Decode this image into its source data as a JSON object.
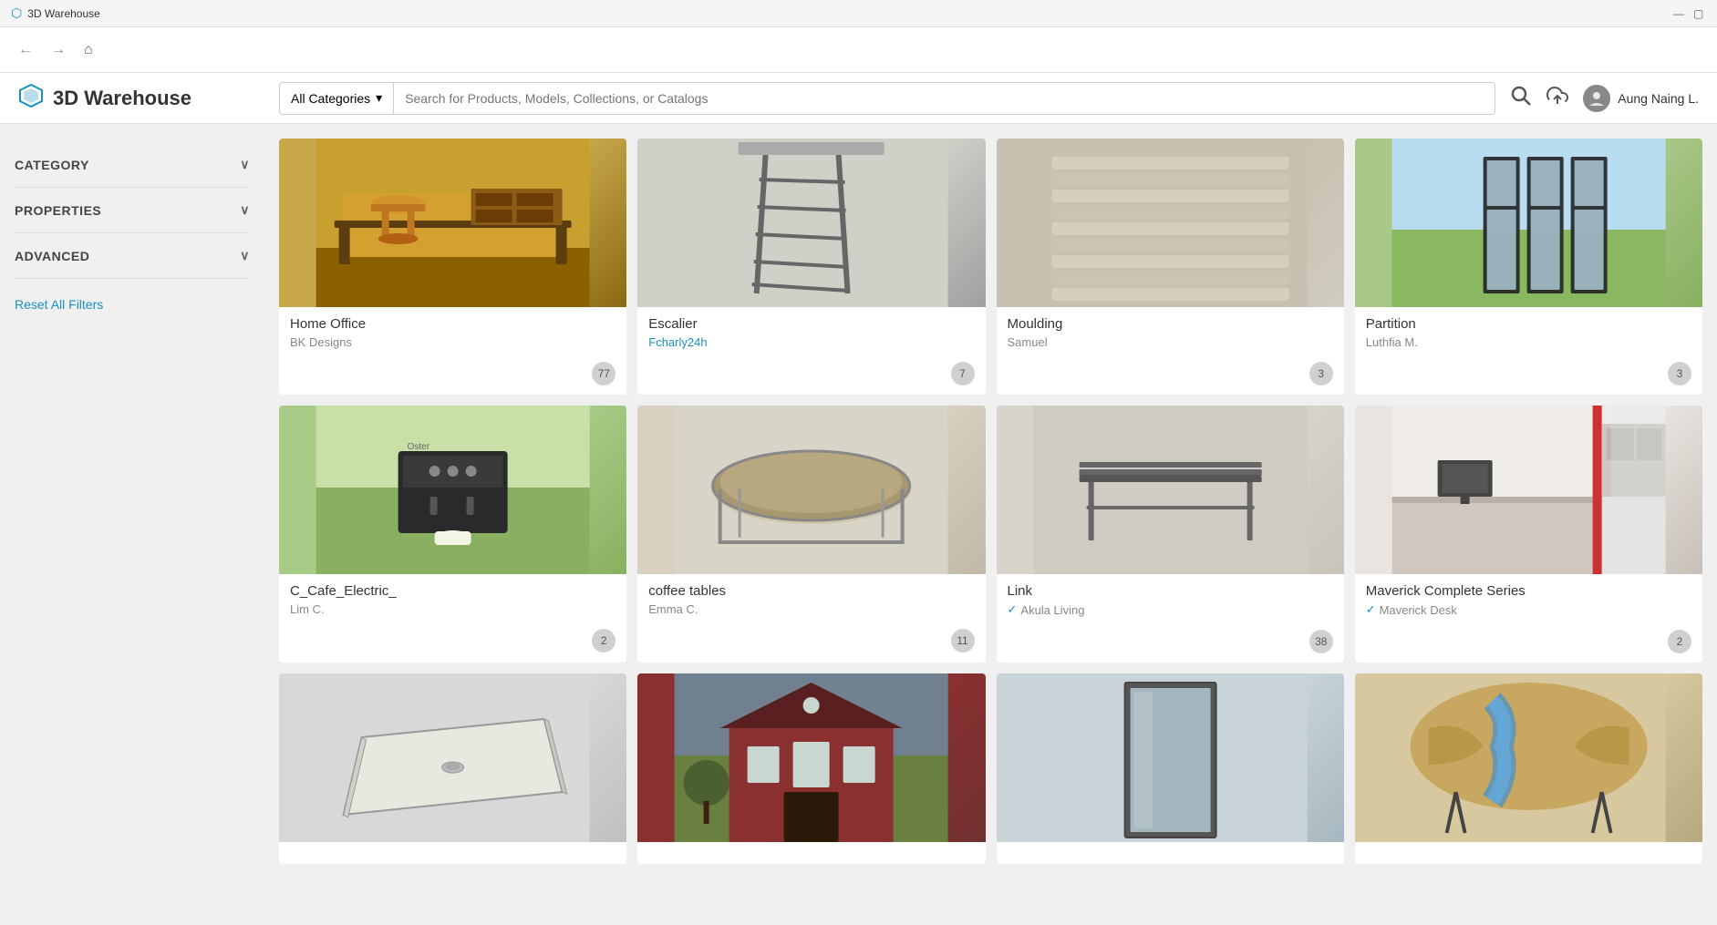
{
  "titleBar": {
    "title": "3D Warehouse",
    "icon": "⬡"
  },
  "navBar": {
    "back": "←",
    "forward": "→",
    "home": "⌂"
  },
  "header": {
    "logoText": "3D Warehouse",
    "categoryDropdown": "All Categories",
    "searchPlaceholder": "Search for Products, Models, Collections, or Catalogs",
    "userName": "Aung Naing L."
  },
  "sidebar": {
    "categoryLabel": "CATEGORY",
    "propertiesLabel": "PROPERTIES",
    "advancedLabel": "ADVANCED",
    "resetLabel": "Reset All Filters"
  },
  "cards": [
    {
      "id": "home-office",
      "title": "Home Office",
      "author": "BK Designs",
      "count": "77",
      "verified": false,
      "imgClass": "card-img-home-office"
    },
    {
      "id": "escalier",
      "title": "Escalier",
      "author": "Fcharly24h",
      "authorLink": true,
      "count": "7",
      "verified": false,
      "imgClass": "card-img-escalier"
    },
    {
      "id": "moulding",
      "title": "Moulding",
      "author": "Samuel",
      "count": "3",
      "verified": false,
      "imgClass": "card-img-moulding"
    },
    {
      "id": "partition",
      "title": "Partition",
      "author": "Luthfia M.",
      "count": "3",
      "verified": false,
      "imgClass": "card-img-partition"
    },
    {
      "id": "c-cafe-electric",
      "title": "C_Cafe_Electric_",
      "author": "Lim C.",
      "count": "2",
      "verified": false,
      "imgClass": "card-img-cafe"
    },
    {
      "id": "coffee-tables",
      "title": "coffee tables",
      "author": "Emma C.",
      "count": "11",
      "verified": false,
      "imgClass": "card-img-coffee"
    },
    {
      "id": "link",
      "title": "Link",
      "author": "Akula Living",
      "count": "38",
      "verified": true,
      "imgClass": "card-img-link"
    },
    {
      "id": "maverick",
      "title": "Maverick Complete Series",
      "author": "Maverick Desk",
      "count": "2",
      "verified": true,
      "imgClass": "card-img-maverick"
    },
    {
      "id": "shower",
      "title": "",
      "author": "",
      "count": "",
      "verified": false,
      "imgClass": "card-img-shower"
    },
    {
      "id": "house",
      "title": "",
      "author": "",
      "count": "",
      "verified": false,
      "imgClass": "card-img-house"
    },
    {
      "id": "mirror",
      "title": "",
      "author": "",
      "count": "",
      "verified": false,
      "imgClass": "card-img-mirror"
    },
    {
      "id": "river-table",
      "title": "",
      "author": "",
      "count": "",
      "verified": false,
      "imgClass": "card-img-table"
    }
  ]
}
